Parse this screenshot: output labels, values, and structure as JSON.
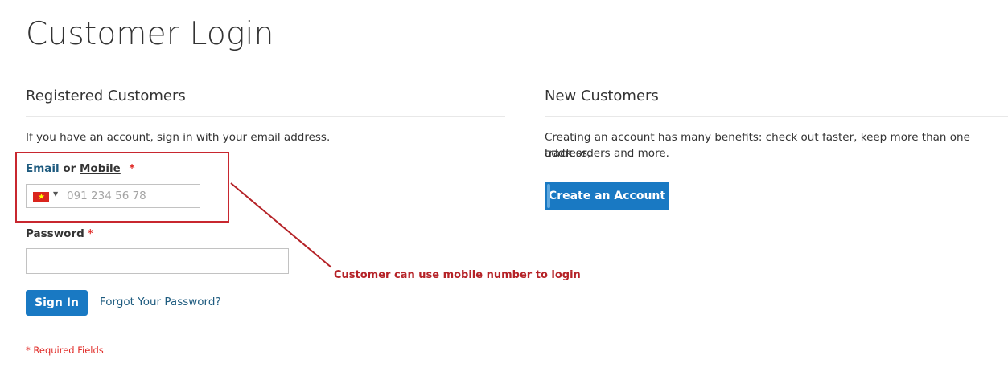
{
  "page_title": "Customer Login",
  "registered": {
    "title": "Registered Customers",
    "intro": "If you have an account, sign in with your email address.",
    "email_label_email": "Email",
    "email_label_or": "or",
    "email_label_mobile": "Mobile",
    "required_mark": "*",
    "phone": {
      "country_flag": "vn-flag-icon",
      "flag_star": "★",
      "caret": "▼",
      "placeholder": "091 234 56 78",
      "value": ""
    },
    "password_label": "Password",
    "password_value": "",
    "sign_in_label": "Sign In",
    "forgot_label": "Forgot Your Password?",
    "required_note": "* Required Fields"
  },
  "new_customers": {
    "title": "New Customers",
    "intro_line1": "Creating an account has many benefits: check out faster, keep more than one address,",
    "intro_line2": "track orders and more.",
    "create_label": "Create an Account"
  },
  "annotation": {
    "text": "Customer can use mobile number to login",
    "color": "#b52227"
  },
  "colors": {
    "primary": "#1979c3",
    "link": "#1e5b7f",
    "required": "#e02b27"
  }
}
